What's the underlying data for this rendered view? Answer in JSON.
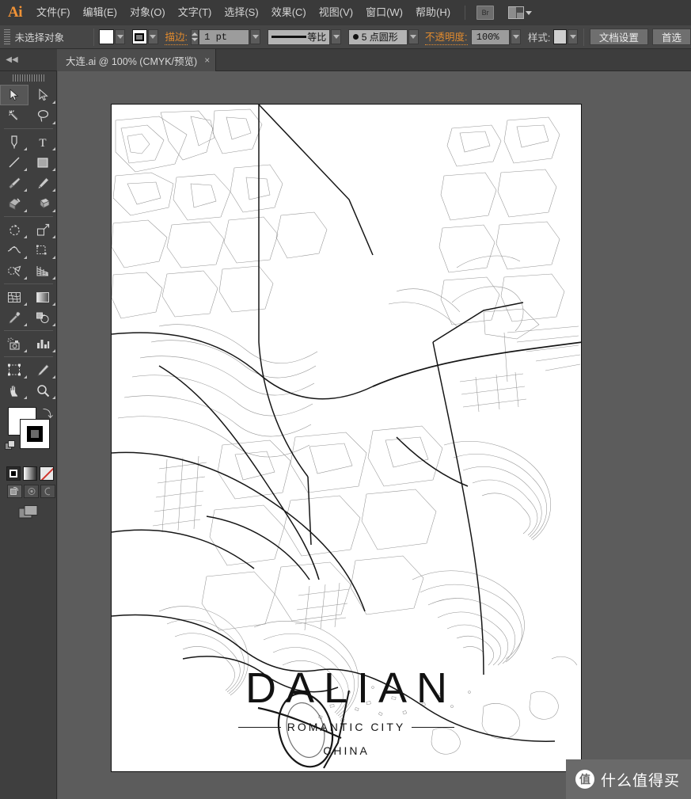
{
  "app": {
    "logo": "Ai",
    "menu_items": [
      {
        "label": "文件(F)"
      },
      {
        "label": "编辑(E)"
      },
      {
        "label": "对象(O)"
      },
      {
        "label": "文字(T)"
      },
      {
        "label": "选择(S)"
      },
      {
        "label": "效果(C)"
      },
      {
        "label": "视图(V)"
      },
      {
        "label": "窗口(W)"
      },
      {
        "label": "帮助(H)"
      }
    ],
    "bridge_button": "Br"
  },
  "control_bar": {
    "selection_status": "未选择对象",
    "stroke_label": "描边:",
    "stroke_weight": "1 pt",
    "stroke_profile": "等比",
    "stroke_cap": "5 点圆形",
    "opacity_label": "不透明度:",
    "opacity_value": "100%",
    "style_label": "样式:",
    "document_setup_button": "文档设置",
    "preferences_button": "首选"
  },
  "tab_bar": {
    "document_tab": "大连.ai @ 100% (CMYK/预览)",
    "close_glyph": "×"
  },
  "tools": [
    {
      "name": "selection-tool",
      "selected": true
    },
    {
      "name": "direct-selection-tool",
      "selected": false
    },
    {
      "name": "magic-wand-tool",
      "selected": false
    },
    {
      "name": "lasso-tool",
      "selected": false
    },
    {
      "name": "pen-tool",
      "selected": false
    },
    {
      "name": "type-tool",
      "selected": false
    },
    {
      "name": "line-segment-tool",
      "selected": false
    },
    {
      "name": "rectangle-tool",
      "selected": false
    },
    {
      "name": "paintbrush-tool",
      "selected": false
    },
    {
      "name": "pencil-tool",
      "selected": false
    },
    {
      "name": "blob-brush-tool",
      "selected": false
    },
    {
      "name": "eraser-tool",
      "selected": false
    },
    {
      "name": "rotate-tool",
      "selected": false
    },
    {
      "name": "scale-tool",
      "selected": false
    },
    {
      "name": "width-tool",
      "selected": false
    },
    {
      "name": "free-transform-tool",
      "selected": false
    },
    {
      "name": "shape-builder-tool",
      "selected": false
    },
    {
      "name": "perspective-grid-tool",
      "selected": false
    },
    {
      "name": "mesh-tool",
      "selected": false
    },
    {
      "name": "gradient-tool",
      "selected": false
    },
    {
      "name": "eyedropper-tool",
      "selected": false
    },
    {
      "name": "blend-tool",
      "selected": false
    },
    {
      "name": "symbol-sprayer-tool",
      "selected": false
    },
    {
      "name": "column-graph-tool",
      "selected": false
    },
    {
      "name": "artboard-tool",
      "selected": false
    },
    {
      "name": "slice-tool",
      "selected": false
    },
    {
      "name": "hand-tool",
      "selected": false
    },
    {
      "name": "zoom-tool",
      "selected": false
    }
  ],
  "colors": {
    "fill": "#ffffff",
    "stroke": "#000000",
    "accent_orange": "#e08a2e",
    "panel_bg": "#3f3f3f",
    "canvas_bg": "#5c5c5c",
    "menubar_bg": "#3a3a3a",
    "artboard_bg": "#ffffff"
  },
  "poster": {
    "city": "DALIAN",
    "tagline": "ROMANTIC  CITY",
    "country": "CHINA"
  },
  "watermark": {
    "badge": "值",
    "text": "什么值得买"
  }
}
